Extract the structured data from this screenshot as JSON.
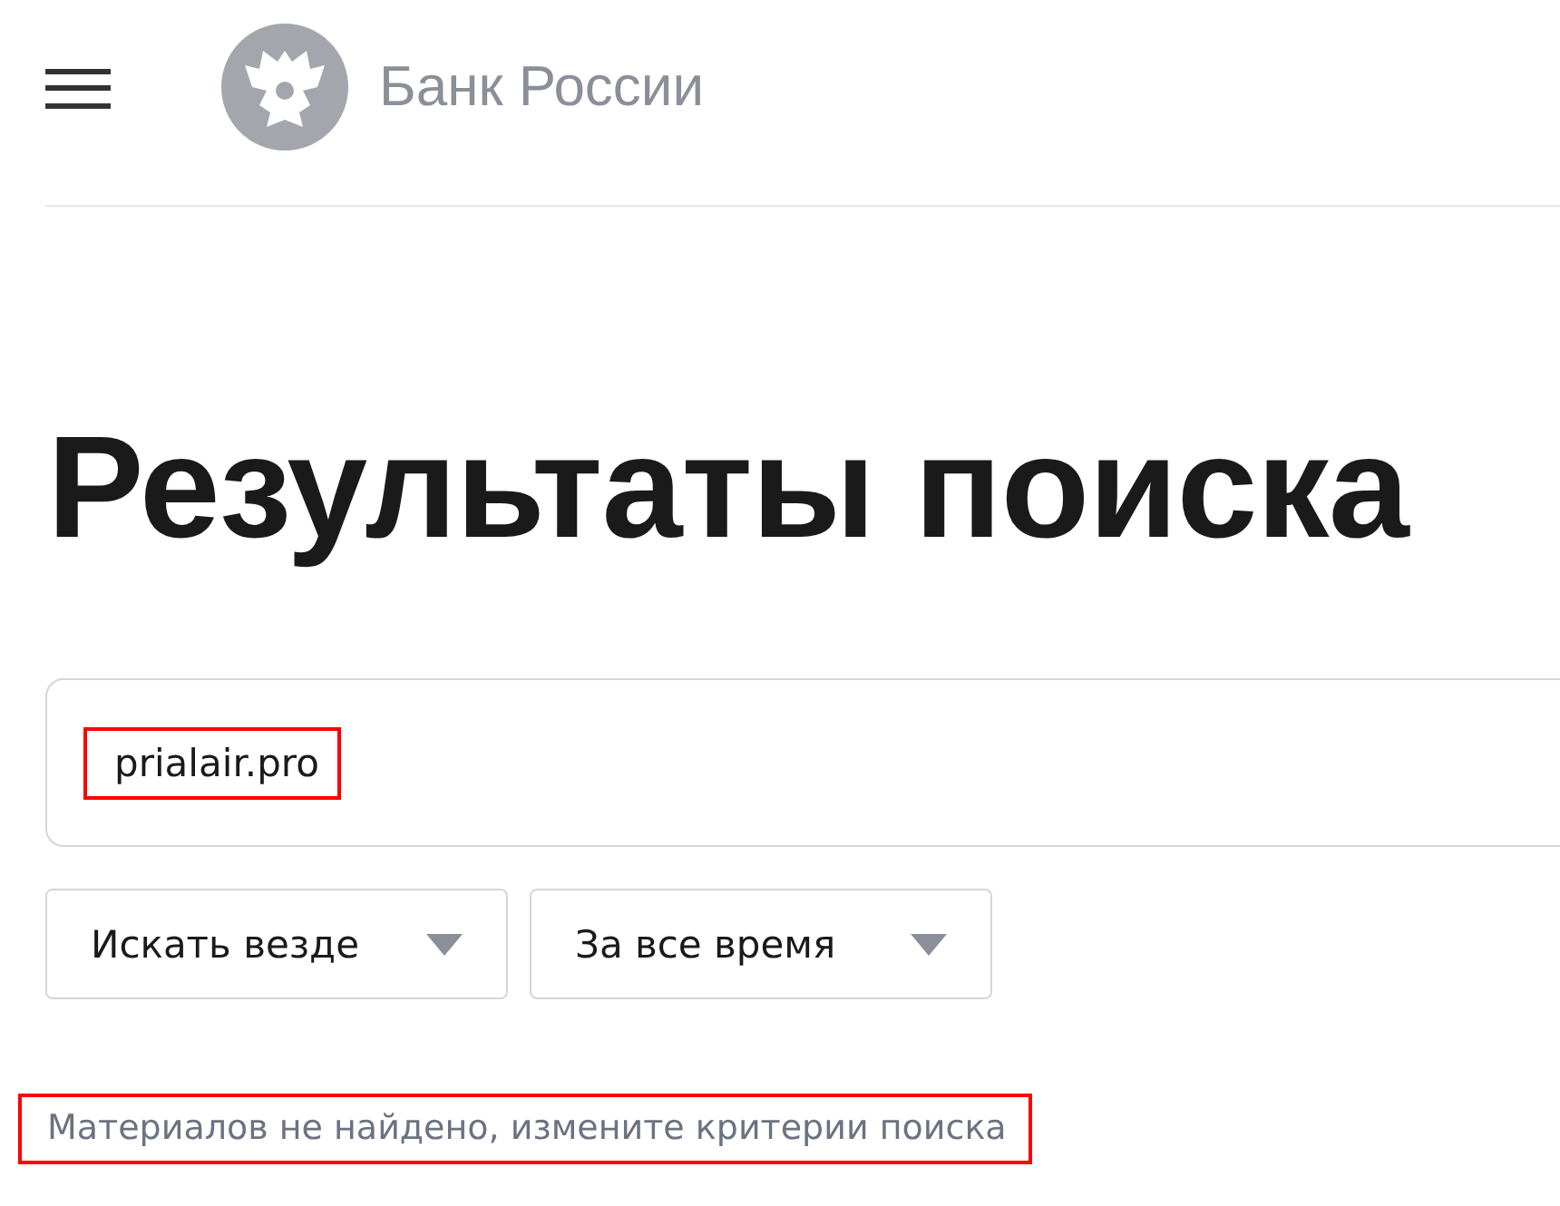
{
  "header": {
    "brand": "Банк России"
  },
  "heading": "Результаты поиска",
  "search": {
    "value": "prialair.pro",
    "highlighted": true
  },
  "filters": [
    {
      "label": "Искать везде"
    },
    {
      "label": "За все время"
    }
  ],
  "message": {
    "text": "Материалов не найдено, измените критерии поиска",
    "highlighted": true
  }
}
